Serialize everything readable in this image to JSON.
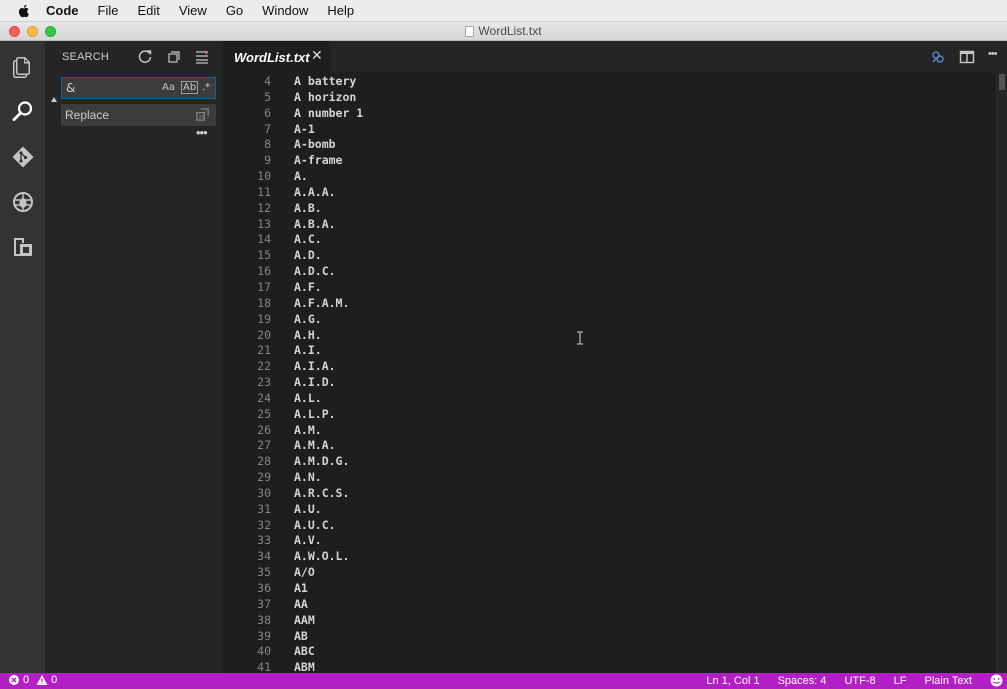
{
  "menubar": {
    "app_name": "Code",
    "items": [
      "File",
      "Edit",
      "View",
      "Go",
      "Window",
      "Help"
    ]
  },
  "window": {
    "title": "WordList.txt"
  },
  "sidebar": {
    "title": "SEARCH",
    "search_value": "&",
    "options": {
      "match_case": "Aa",
      "whole_word": "Ab",
      "regex": ".*"
    },
    "replace_placeholder": "Replace",
    "more": "•••"
  },
  "editor": {
    "tab_label": "WordList.txt",
    "tab_close": "✕",
    "more_actions": "•••",
    "line_numbers": [
      "4",
      "5",
      "6",
      "7",
      "8",
      "9",
      "10",
      "11",
      "12",
      "13",
      "14",
      "15",
      "16",
      "17",
      "18",
      "19",
      "20",
      "21",
      "22",
      "23",
      "24",
      "25",
      "26",
      "27",
      "28",
      "29",
      "30",
      "31",
      "32",
      "33",
      "34",
      "35",
      "36",
      "37",
      "38",
      "39",
      "40",
      "41"
    ],
    "lines": [
      "A battery",
      "A horizon",
      "A number 1",
      "A-1",
      "A-bomb",
      "A-frame",
      "A.",
      "A.A.A.",
      "A.B.",
      "A.B.A.",
      "A.C.",
      "A.D.",
      "A.D.C.",
      "A.F.",
      "A.F.A.M.",
      "A.G.",
      "A.H.",
      "A.I.",
      "A.I.A.",
      "A.I.D.",
      "A.L.",
      "A.L.P.",
      "A.M.",
      "A.M.A.",
      "A.M.D.G.",
      "A.N.",
      "A.R.C.S.",
      "A.U.",
      "A.U.C.",
      "A.V.",
      "A.W.O.L.",
      "A/O",
      "A1",
      "AA",
      "AAM",
      "AB",
      "ABC",
      "ABM"
    ]
  },
  "statusbar": {
    "errors": "0",
    "warnings": "0",
    "position": "Ln 1, Col 1",
    "spaces": "Spaces: 4",
    "encoding": "UTF-8",
    "eol": "LF",
    "language": "Plain Text"
  },
  "colors": {
    "statusbar": "#b21fc5",
    "activitybar": "#333333",
    "sidebar": "#252526",
    "editor": "#1e1e1e",
    "focus_border": "#0e639c"
  }
}
